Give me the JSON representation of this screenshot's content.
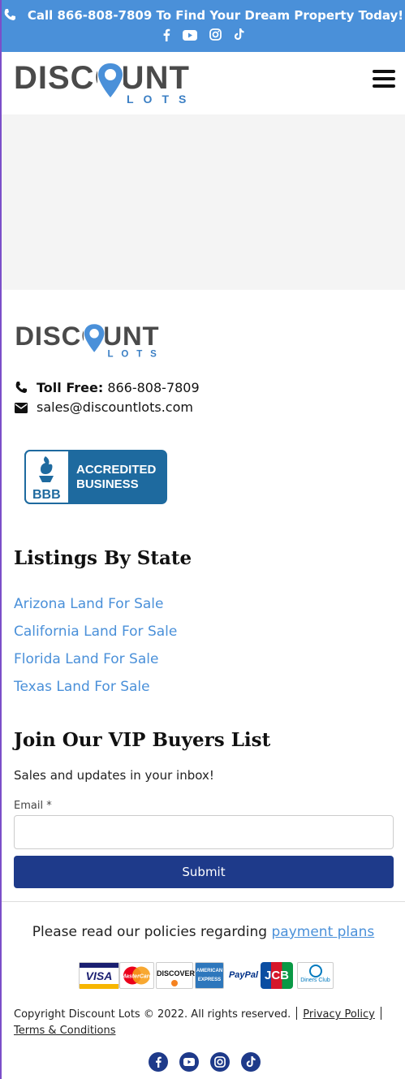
{
  "topbar": {
    "call_text": "Call 866-808-7809 To Find Your Dream Property Today!",
    "social_icons": [
      "facebook-icon",
      "youtube-icon",
      "instagram-icon",
      "tiktok-icon"
    ]
  },
  "brand": {
    "logo_word": "DISCOUNT",
    "logo_sub": "LOTS",
    "colors": {
      "primary": "#4a90d9",
      "dark_blue": "#1e3a8a",
      "logo_gray": "#4a4a4a"
    }
  },
  "contact": {
    "toll_free_label": "Toll Free:",
    "toll_free_number": "866-808-7809",
    "email": "sales@discountlots.com"
  },
  "bbb": {
    "line1": "ACCREDITED",
    "line2": "BUSINESS",
    "mark": "BBB"
  },
  "listings": {
    "heading": "Listings By State",
    "links": [
      "Arizona Land For Sale",
      "California Land For Sale",
      "Florida Land For Sale",
      "Texas Land For Sale"
    ]
  },
  "vip": {
    "heading": "Join Our VIP Buyers List",
    "subtitle": "Sales and updates in your inbox!",
    "email_label": "Email *",
    "email_value": "",
    "submit_label": "Submit"
  },
  "footer": {
    "policy_text": "Please read our policies regarding",
    "policy_link": "payment plans",
    "cards": [
      "VISA",
      "MasterCard",
      "DISCOVER",
      "AMERICAN EXPRESS",
      "PayPal",
      "JCB",
      "Diners Club"
    ],
    "copyright": "Copyright Discount Lots © 2022. All rights reserved.",
    "privacy_link": "Privacy Policy",
    "terms_link": "Terms & Conditions"
  }
}
